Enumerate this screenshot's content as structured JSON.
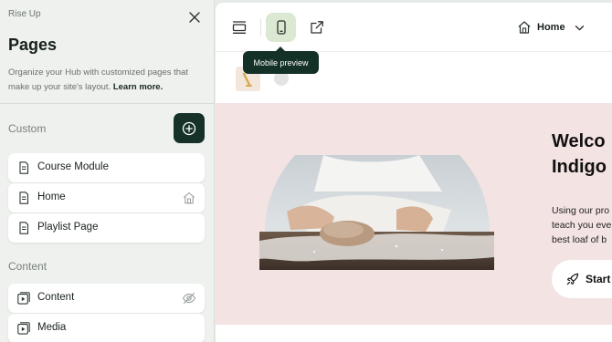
{
  "sidebar": {
    "site_name": "Rise Up",
    "title": "Pages",
    "description": "Organize your Hub with customized pages that make up your site's layout.",
    "learn_more": "Learn more.",
    "custom_label": "Custom",
    "content_label": "Content",
    "custom_pages": [
      {
        "label": "Course Module",
        "icon": "page-icon",
        "trail_icon": ""
      },
      {
        "label": "Home",
        "icon": "page-icon",
        "trail_icon": "home-icon"
      },
      {
        "label": "Playlist Page",
        "icon": "page-icon",
        "trail_icon": ""
      }
    ],
    "content_pages": [
      {
        "label": "Content",
        "icon": "content-icon",
        "trail_icon": "hidden-eye-icon"
      },
      {
        "label": "Media",
        "icon": "media-icon",
        "trail_icon": ""
      }
    ]
  },
  "toolbar": {
    "tooltip": "Mobile preview",
    "page_select": "Home"
  },
  "preview": {
    "hero_title": "Welco\nIndigo",
    "hero_text": "Using our pro\nteach you eve\nbest loaf of b",
    "cta_label": "Start"
  },
  "colors": {
    "accent_dark": "#153128",
    "active_button_bg": "#dbe8d2",
    "hero_bg": "#f4e3e3",
    "sidebar_bg": "#eef1ee"
  }
}
